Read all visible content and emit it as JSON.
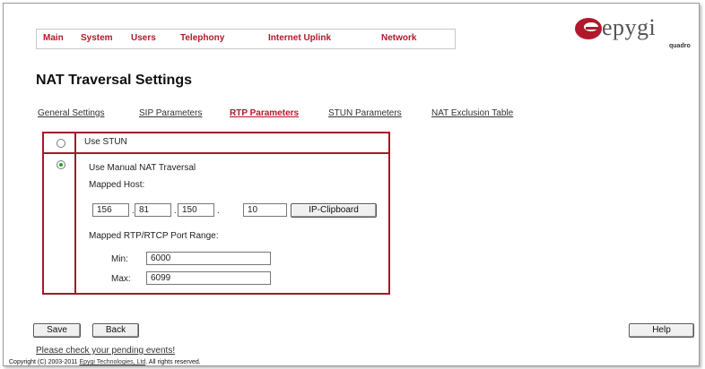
{
  "nav": {
    "items": [
      "Main",
      "System",
      "Users",
      "Telephony",
      "Internet Uplink",
      "Network"
    ]
  },
  "logo": {
    "brand": "epygi",
    "sub": "quadro",
    "icon": "epygi-e-logo",
    "color": "#b2182b"
  },
  "page": {
    "title": "NAT Traversal Settings"
  },
  "tabs": {
    "items": [
      "General Settings",
      "SIP Parameters",
      "RTP Parameters",
      "STUN Parameters",
      "NAT Exclusion Table"
    ],
    "active": "RTP Parameters"
  },
  "options": {
    "stun_label": "Use STUN",
    "stun_selected": false,
    "manual_label": "Use Manual NAT Traversal",
    "manual_selected": true
  },
  "mapped_host": {
    "label": "Mapped Host:",
    "octets": [
      "156",
      "81",
      "150",
      "10"
    ],
    "clipboard_button": "IP-Clipboard"
  },
  "port_range": {
    "label": "Mapped RTP/RTCP Port Range:",
    "min_label": "Min:",
    "min_value": "6000",
    "max_label": "Max:",
    "max_value": "6099"
  },
  "buttons": {
    "save": "Save",
    "back": "Back",
    "help": "Help"
  },
  "footer": {
    "events_link": "Please check your pending events!",
    "copyright_prefix": "Copyright (C) 2003-2011 ",
    "copyright_link": "Epygi Technologies, Ltd",
    "copyright_suffix": ". All rights reserved."
  },
  "colors": {
    "accent": "#b2182b",
    "panel_border": "#9e1b2b",
    "radio_selected": "#2e9a2e"
  }
}
